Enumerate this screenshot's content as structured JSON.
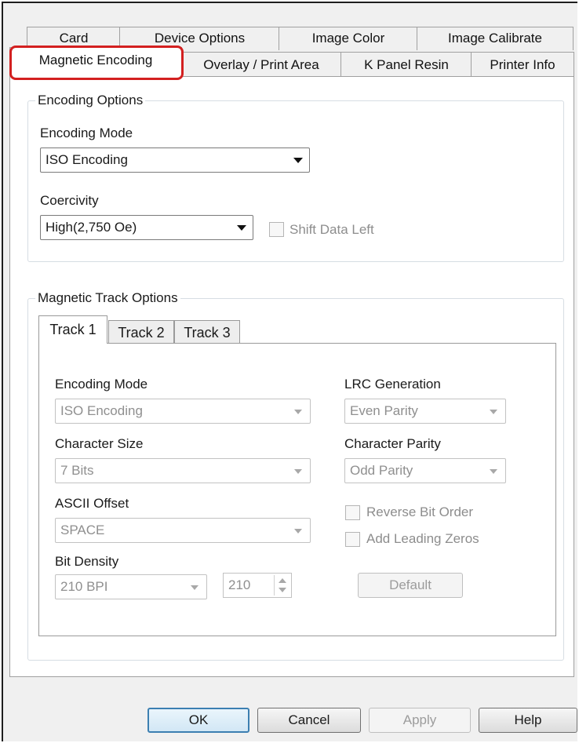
{
  "tabs_row1": [
    "Card",
    "Device Options",
    "Image Color",
    "Image Calibrate"
  ],
  "tabs_row2": [
    "Magnetic Encoding",
    "Overlay / Print Area",
    "K Panel Resin",
    "Printer Info"
  ],
  "active_tab": "Magnetic Encoding",
  "highlight_color": "#d32020",
  "encoding_options": {
    "title": "Encoding Options",
    "encoding_mode_label": "Encoding Mode",
    "encoding_mode_value": "ISO Encoding",
    "coercivity_label": "Coercivity",
    "coercivity_value": "High(2,750 Oe)",
    "shift_data_left_label": "Shift Data Left",
    "shift_data_left_checked": false
  },
  "track_options": {
    "title": "Magnetic Track Options",
    "tracks": [
      "Track 1",
      "Track 2",
      "Track 3"
    ],
    "active_track": "Track 1",
    "encoding_mode_label": "Encoding Mode",
    "encoding_mode_value": "ISO Encoding",
    "character_size_label": "Character Size",
    "character_size_value": "7 Bits",
    "ascii_offset_label": "ASCII Offset",
    "ascii_offset_value": "SPACE",
    "bit_density_label": "Bit Density",
    "bit_density_value": "210 BPI",
    "bit_density_spin": "210",
    "lrc_label": "LRC Generation",
    "lrc_value": "Even Parity",
    "char_parity_label": "Character Parity",
    "char_parity_value": "Odd Parity",
    "reverse_bit_label": "Reverse Bit Order",
    "leading_zeros_label": "Add Leading Zeros",
    "default_button": "Default"
  },
  "buttons": {
    "ok": "OK",
    "cancel": "Cancel",
    "apply": "Apply",
    "help": "Help"
  }
}
